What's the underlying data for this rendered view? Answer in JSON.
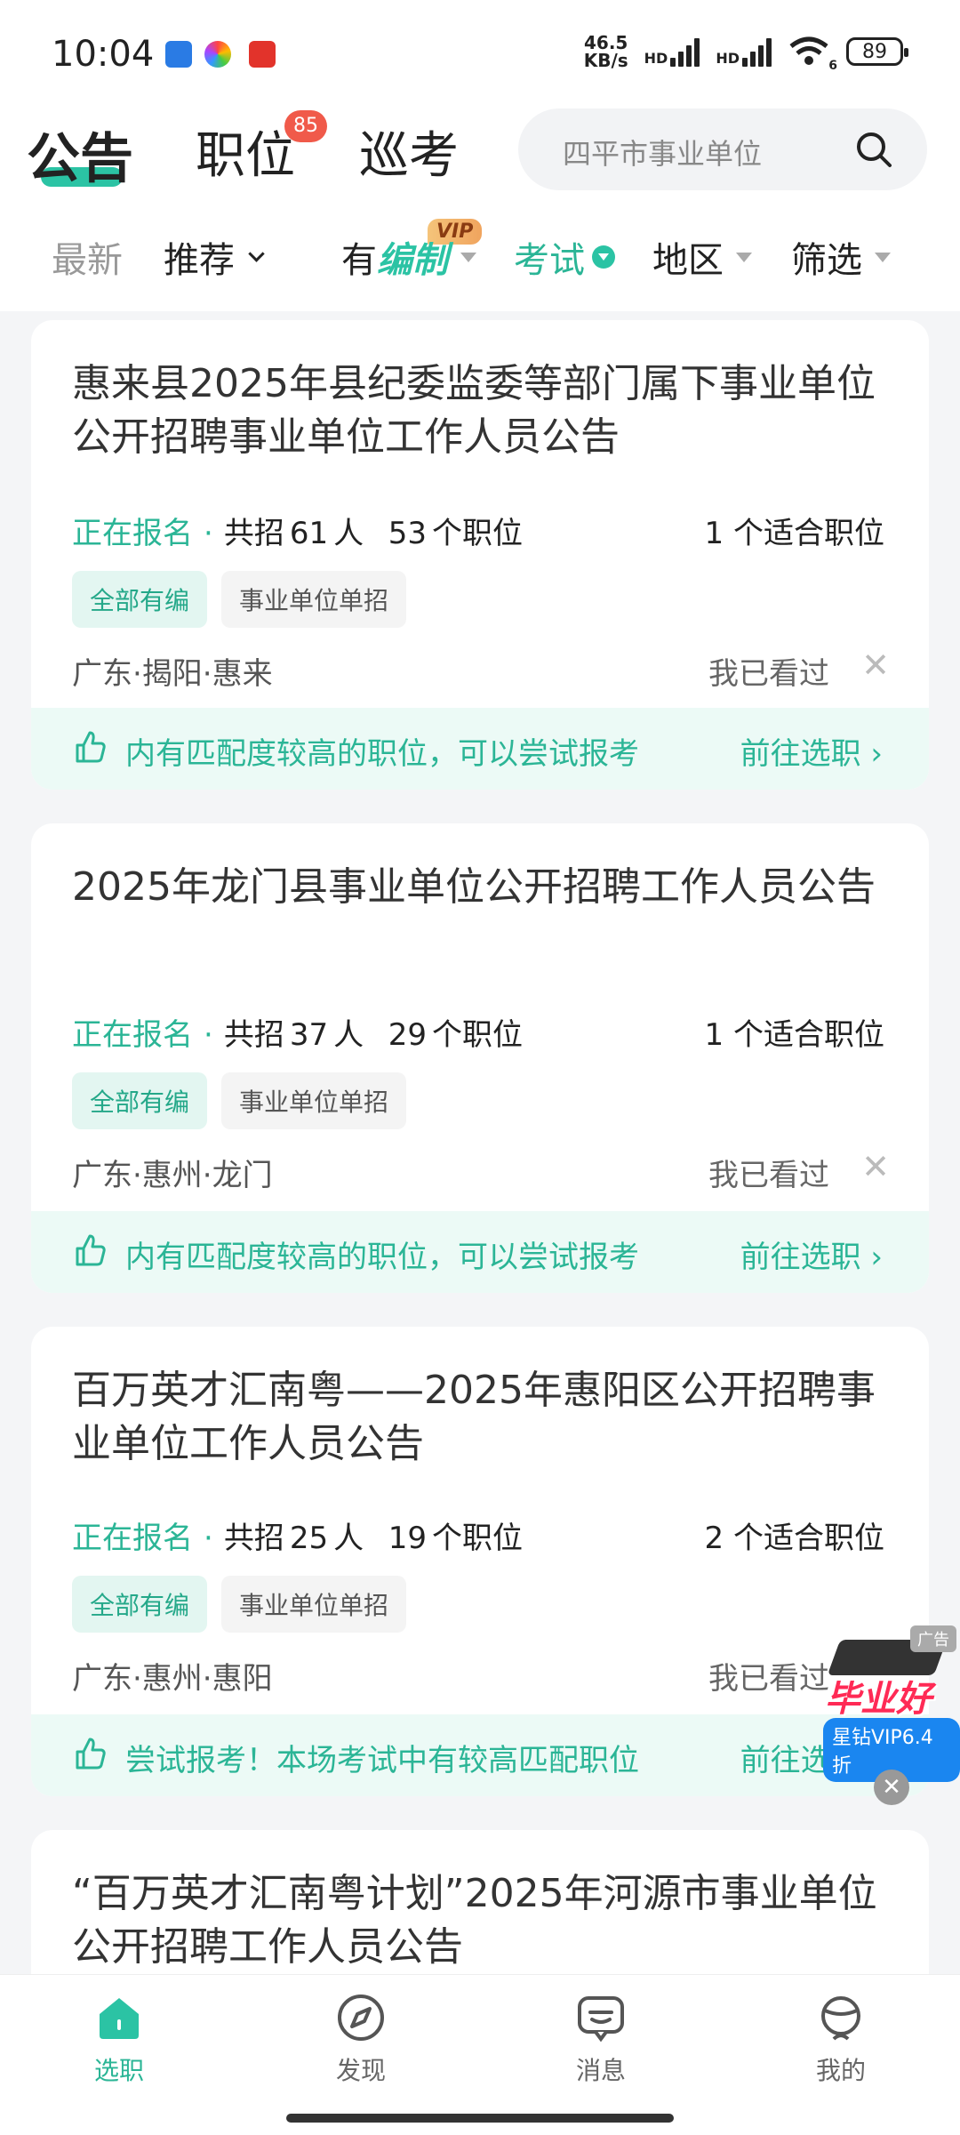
{
  "status_bar": {
    "time": "10:04",
    "net_speed_top": "46.5",
    "net_speed_bottom": "KB/s",
    "sig1": "HD",
    "sig2": "HD",
    "wifi_num": "6",
    "battery": "89"
  },
  "tabs": {
    "announcement": "公告",
    "position": "职位",
    "position_badge": "85",
    "patrol": "巡考"
  },
  "search": {
    "placeholder": "四平市事业单位"
  },
  "filters": {
    "latest": "最新",
    "recommend": "推荐",
    "staff_prefix": "有",
    "staff_highlight": "编制",
    "vip_badge": "VIP",
    "exam": "考试",
    "region": "地区",
    "filter": "筛选"
  },
  "cards": [
    {
      "title": "惠来县2025年县纪委监委等部门属下事业单位公开招聘事业单位工作人员公告",
      "status": "正在报名",
      "recruit_prefix": "共招",
      "recruit_count": "61",
      "recruit_unit": "人",
      "positions_count": "53",
      "positions_unit": "个职位",
      "fit_count": "1",
      "fit_unit": "个适合职位",
      "tag1": "全部有编",
      "tag2": "事业单位单招",
      "location": "广东·揭阳·惠来",
      "seen": "我已看过",
      "banner_text": "内有匹配度较高的职位，可以尝试报考",
      "banner_link": "前往选职"
    },
    {
      "title": "2025年龙门县事业单位公开招聘工作人员公告",
      "status": "正在报名",
      "recruit_prefix": "共招",
      "recruit_count": "37",
      "recruit_unit": "人",
      "positions_count": "29",
      "positions_unit": "个职位",
      "fit_count": "1",
      "fit_unit": "个适合职位",
      "tag1": "全部有编",
      "tag2": "事业单位单招",
      "location": "广东·惠州·龙门",
      "seen": "我已看过",
      "banner_text": "内有匹配度较高的职位，可以尝试报考",
      "banner_link": "前往选职"
    },
    {
      "title": "百万英才汇南粤——2025年惠阳区公开招聘事业单位工作人员公告",
      "status": "正在报名",
      "recruit_prefix": "共招",
      "recruit_count": "25",
      "recruit_unit": "人",
      "positions_count": "19",
      "positions_unit": "个职位",
      "fit_count": "2",
      "fit_unit": "个适合职位",
      "tag1": "全部有编",
      "tag2": "事业单位单招",
      "location": "广东·惠州·惠阳",
      "seen": "我已看过",
      "banner_text": "尝试报考！本场考试中有较高匹配职位",
      "banner_link": "前往选职"
    },
    {
      "title": "“百万英才汇南粤计划”2025年河源市事业单位公开招聘工作人员公告"
    }
  ],
  "ad": {
    "label": "广告",
    "main": "毕业好礼",
    "sub": "星钻VIP6.4折"
  },
  "bottom_nav": {
    "select": "选职",
    "discover": "发现",
    "messages": "消息",
    "mine": "我的"
  },
  "colors": {
    "accent": "#2bb596",
    "badge": "#f05a4a"
  }
}
